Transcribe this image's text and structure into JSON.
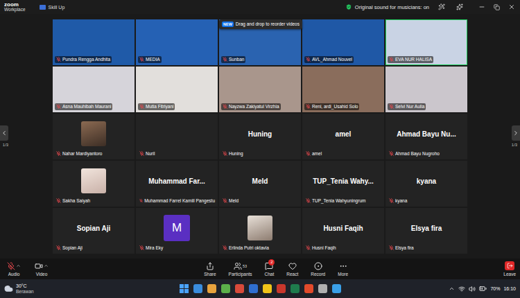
{
  "window": {
    "logo": "zoom",
    "logo_sub": "Workplace",
    "title": "Skill Up",
    "sound_status": "Original sound for musicians: on"
  },
  "gallery": {
    "prev_page": "1/3",
    "next_page": "1/3",
    "tooltip": {
      "badge": "NEW",
      "text": "Drag and drop to reorder videos"
    },
    "tiles": [
      {
        "name": "Pundra Rengga Andhita",
        "kind": "video",
        "muted": true,
        "speaking": false,
        "hint": false
      },
      {
        "name": "MEDIA",
        "kind": "video",
        "muted": true,
        "speaking": false,
        "hint": false
      },
      {
        "name": "Sunban",
        "kind": "video",
        "muted": true,
        "speaking": false,
        "hint": true
      },
      {
        "name": "AVL_Ahmad Nouvel",
        "kind": "video",
        "muted": true,
        "speaking": false,
        "hint": false
      },
      {
        "name": "EVA NUR HALISA",
        "kind": "video",
        "muted": true,
        "speaking": true,
        "hint": false
      },
      {
        "name": "Asna Mauhibah Maurani",
        "kind": "video",
        "muted": true,
        "speaking": false,
        "hint": false
      },
      {
        "name": "Mutia Fitriyani",
        "kind": "video",
        "muted": true,
        "speaking": false,
        "hint": false
      },
      {
        "name": "Nayzwa Zakiyatul Virzhia",
        "kind": "video",
        "muted": true,
        "speaking": false,
        "hint": false
      },
      {
        "name": "Reni, ardi_Usahid Solo",
        "kind": "video",
        "muted": true,
        "speaking": false,
        "hint": false
      },
      {
        "name": "Selvi Nur Aulia",
        "kind": "video",
        "muted": true,
        "speaking": false,
        "hint": false
      },
      {
        "name": "Nahar Mardiyantoro",
        "kind": "photo",
        "muted": true,
        "speaking": false,
        "hint": false
      },
      {
        "name": "Nuril",
        "kind": "blank",
        "muted": true,
        "speaking": false,
        "hint": false
      },
      {
        "name": "Huning",
        "kind": "name",
        "center": "Huning",
        "muted": true,
        "speaking": false,
        "hint": false
      },
      {
        "name": "amel",
        "kind": "name",
        "center": "amel",
        "muted": true,
        "speaking": false,
        "hint": false
      },
      {
        "name": "Ahmad Bayu Nugroho",
        "kind": "name",
        "center": "Ahmad Bayu Nu...",
        "muted": true,
        "speaking": false,
        "hint": false
      },
      {
        "name": "Sakha Saiyah",
        "kind": "photo",
        "muted": true,
        "speaking": false,
        "hint": false
      },
      {
        "name": "Muhammad Farrel Kamiil Pangestu",
        "kind": "name",
        "center": "Muhammad Far...",
        "muted": true,
        "speaking": false,
        "hint": false
      },
      {
        "name": "Meld",
        "kind": "name",
        "center": "Meld",
        "muted": true,
        "speaking": false,
        "hint": false
      },
      {
        "name": "TUP_Tenia Wahyuningrum",
        "kind": "name",
        "center": "TUP_Tenia Wahy...",
        "muted": true,
        "speaking": false,
        "hint": false
      },
      {
        "name": "kyana",
        "kind": "name",
        "center": "kyana",
        "muted": true,
        "speaking": false,
        "hint": false
      },
      {
        "name": "Sopian Aji",
        "kind": "name",
        "center": "Sopian Aji",
        "muted": true,
        "speaking": false,
        "hint": false
      },
      {
        "name": "Mira Eky",
        "kind": "letter",
        "letter": "M",
        "muted": true,
        "speaking": false,
        "hint": false
      },
      {
        "name": "Erlinda Putri oktavia",
        "kind": "photo",
        "muted": true,
        "speaking": false,
        "hint": false
      },
      {
        "name": "Husni Faqih",
        "kind": "name",
        "center": "Husni Faqih",
        "muted": true,
        "speaking": false,
        "hint": false
      },
      {
        "name": "Elsya fira",
        "kind": "name",
        "center": "Elsya fira",
        "muted": true,
        "speaking": false,
        "hint": false
      }
    ]
  },
  "toolbar": {
    "audio": {
      "label": "Audio",
      "muted": true
    },
    "video": {
      "label": "Video",
      "off": false
    },
    "center": [
      {
        "label": "Share"
      },
      {
        "label": "Participants",
        "count": "53"
      },
      {
        "label": "Chat",
        "badge": "2"
      },
      {
        "label": "React"
      },
      {
        "label": "Record"
      },
      {
        "label": "More"
      }
    ],
    "leave": "Leave"
  },
  "taskbar": {
    "temperature": "30°C",
    "weather": "Berawan",
    "battery": "70%",
    "time": "16:10"
  }
}
